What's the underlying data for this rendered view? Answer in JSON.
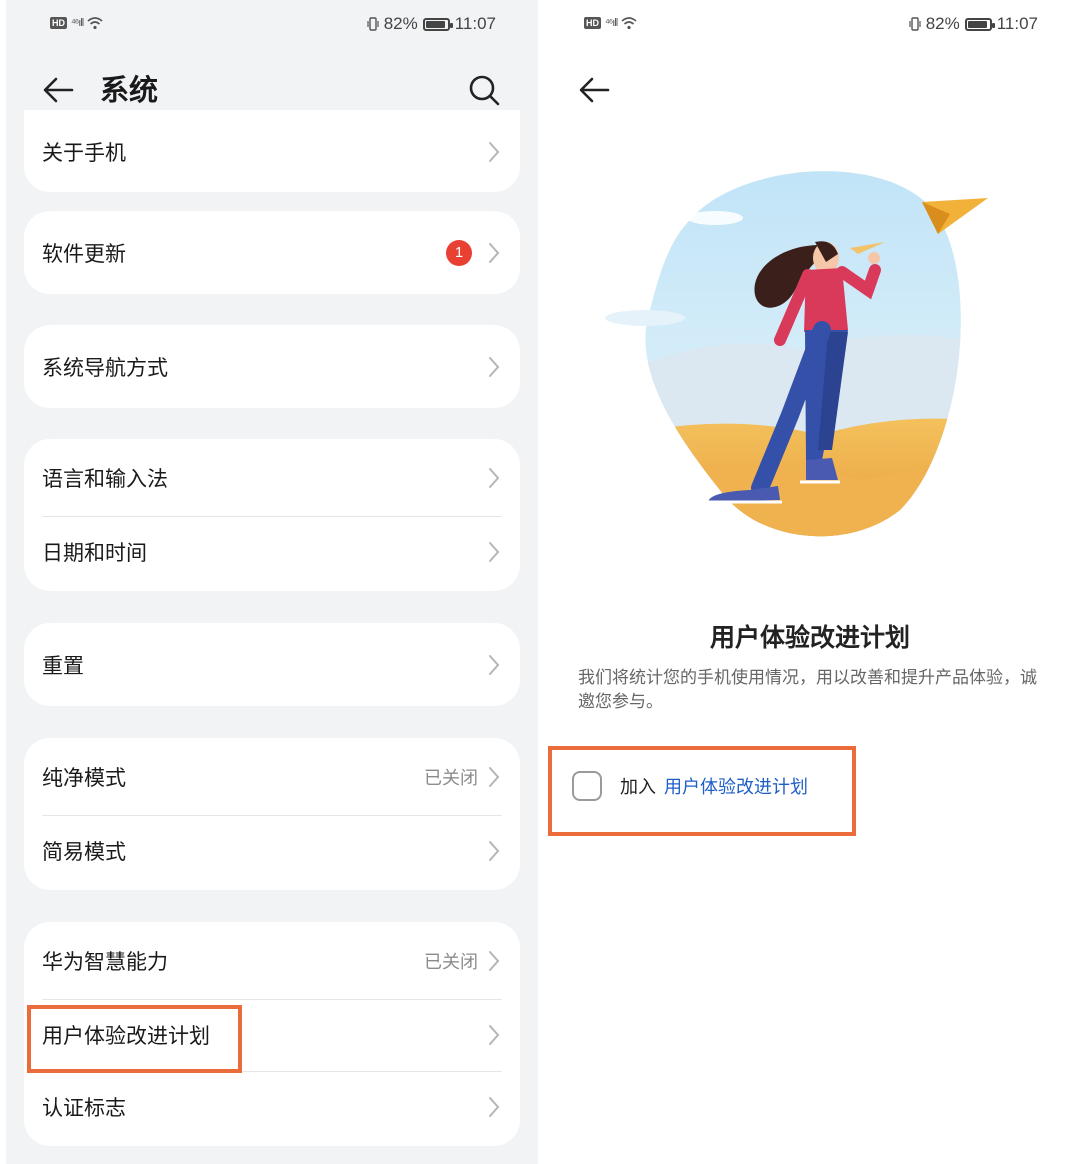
{
  "status_bar": {
    "network": "HD",
    "signal": "⁴⁶ıll",
    "battery_text": "82%",
    "battery_level": 0.82,
    "time": "11:07"
  },
  "left_panel": {
    "title": "系统",
    "items": [
      {
        "label": "关于手机"
      },
      {
        "label": "软件更新",
        "badge": "1"
      },
      {
        "label": "系统导航方式"
      },
      {
        "label": "语言和输入法"
      },
      {
        "label": "日期和时间"
      },
      {
        "label": "重置"
      },
      {
        "label": "纯净模式",
        "value": "已关闭"
      },
      {
        "label": "简易模式"
      },
      {
        "label": "华为智慧能力",
        "value": "已关闭"
      },
      {
        "label": "用户体验改进计划"
      },
      {
        "label": "认证标志"
      }
    ]
  },
  "right_panel": {
    "plan_title": "用户体验改进计划",
    "description": "我们将统计您的手机使用情况，用以改善和提升产品体验，诚邀您参与。",
    "join_prefix": "加入",
    "join_link": "用户体验改进计划",
    "checkbox_checked": false
  },
  "colors": {
    "accent_link": "#1f5fc8",
    "highlight_border": "#ec6b3b",
    "badge": "#e84033",
    "page_bg_left": "#f1f3f5"
  },
  "icons": [
    "back-arrow-icon",
    "search-icon",
    "chevron-right-icon",
    "wifi-icon",
    "battery-icon",
    "vibrate-icon"
  ]
}
